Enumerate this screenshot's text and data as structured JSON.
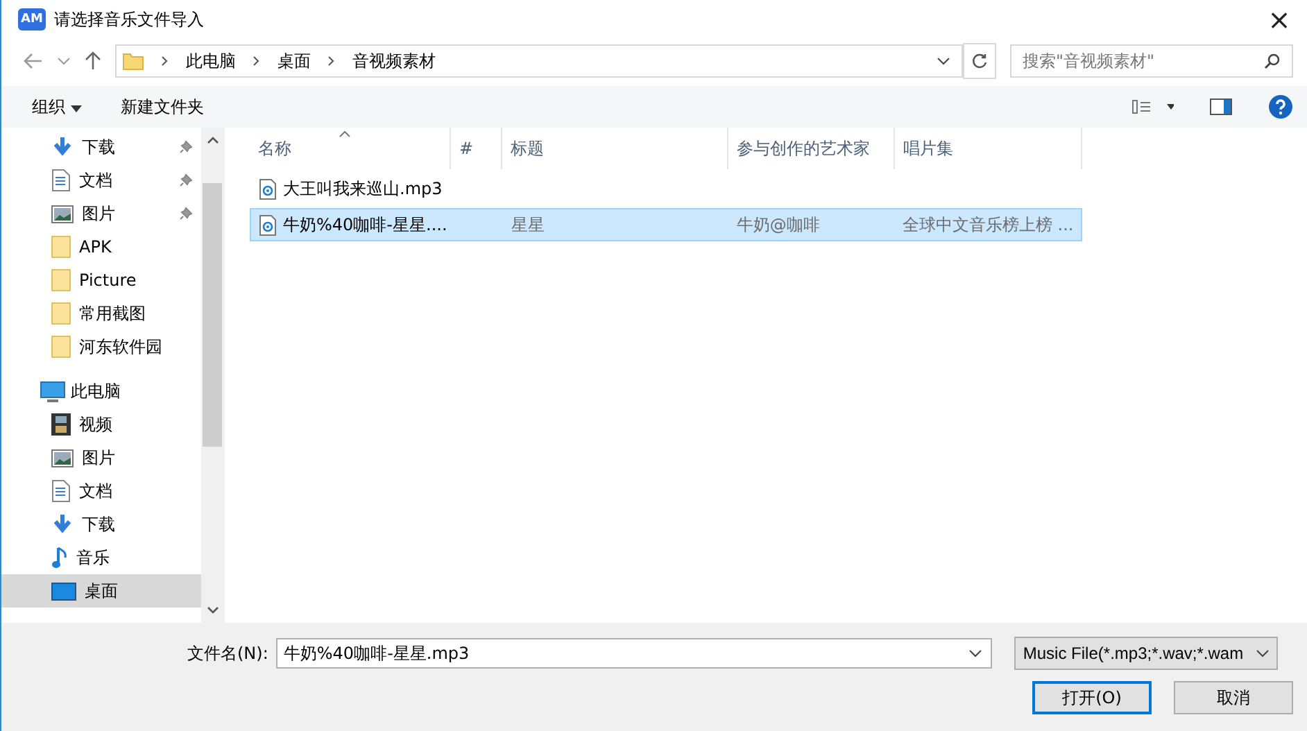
{
  "window": {
    "app_badge": "AM",
    "title": "请选择音乐文件导入",
    "close": "×"
  },
  "address": {
    "path": [
      "此电脑",
      "桌面",
      "音视频素材"
    ],
    "search_placeholder": "搜索\"音视频素材\""
  },
  "toolbar": {
    "organize": "组织",
    "new_folder": "新建文件夹"
  },
  "sidebar": {
    "items": [
      {
        "label": "下载",
        "kind": "download",
        "pinned": true,
        "selected": false
      },
      {
        "label": "文档",
        "kind": "document",
        "pinned": true,
        "selected": false
      },
      {
        "label": "图片",
        "kind": "picture",
        "pinned": true,
        "selected": false
      },
      {
        "label": "APK",
        "kind": "folder",
        "pinned": false,
        "selected": false
      },
      {
        "label": "Picture",
        "kind": "folder",
        "pinned": false,
        "selected": false
      },
      {
        "label": "常用截图",
        "kind": "folder",
        "pinned": false,
        "selected": false
      },
      {
        "label": "河东软件园",
        "kind": "folder",
        "pinned": false,
        "selected": false
      },
      {
        "label": "此电脑",
        "kind": "pc",
        "pinned": false,
        "selected": false,
        "children": [
          {
            "label": "视频",
            "kind": "video",
            "pinned": false,
            "selected": false
          },
          {
            "label": "图片",
            "kind": "picture",
            "pinned": false,
            "selected": false
          },
          {
            "label": "文档",
            "kind": "document",
            "pinned": false,
            "selected": false
          },
          {
            "label": "下载",
            "kind": "download",
            "pinned": false,
            "selected": false
          },
          {
            "label": "音乐",
            "kind": "music",
            "pinned": false,
            "selected": false
          },
          {
            "label": "桌面",
            "kind": "desktop",
            "pinned": false,
            "selected": true
          }
        ]
      }
    ]
  },
  "table": {
    "columns": [
      {
        "label": "名称",
        "sorted": true
      },
      {
        "label": "#",
        "sorted": false
      },
      {
        "label": "标题",
        "sorted": false
      },
      {
        "label": "参与创作的艺术家",
        "sorted": false
      },
      {
        "label": "唱片集",
        "sorted": false
      }
    ],
    "rows": [
      {
        "selected": false,
        "cells": [
          "大王叫我来巡山.mp3",
          "",
          "",
          "",
          ""
        ]
      },
      {
        "selected": true,
        "cells": [
          "牛奶%40咖啡-星星....",
          "",
          "星星",
          "牛奶@咖啡",
          "全球中文音乐榜上榜 ..."
        ]
      }
    ]
  },
  "footer": {
    "filename_label": "文件名(N):",
    "filename": "牛奶%40咖啡-星星.mp3",
    "filter": "Music File(*.mp3;*.wav;*.wam",
    "open": "打开(O)",
    "cancel": "取消"
  }
}
